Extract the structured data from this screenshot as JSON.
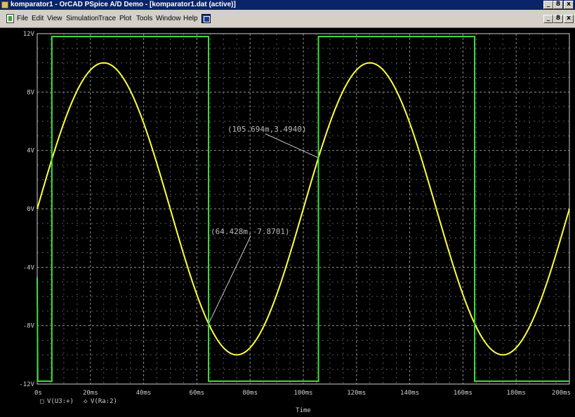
{
  "window": {
    "title": "komparator1 - OrCAD PSpice A/D Demo  - [komparator1.dat (active)]",
    "controls": [
      "_",
      "8",
      "x"
    ],
    "child_controls": [
      "_",
      "8",
      "x"
    ]
  },
  "menu": {
    "items": [
      "File",
      "Edit",
      "View",
      "Simulation",
      "Trace",
      "Plot",
      "Tools",
      "Window",
      "Help"
    ]
  },
  "colors": {
    "background": "#000000",
    "grid": "#a0a0a0",
    "sine": "#ffff40",
    "square": "#40e040"
  },
  "chart_data": {
    "type": "line",
    "title": "",
    "xlabel": "Time",
    "ylabel": "",
    "xlim": [
      0,
      200
    ],
    "ylim": [
      -12,
      12
    ],
    "x_unit": "ms",
    "y_unit": "V",
    "grid": true,
    "legend_placement": "bottom-left",
    "x_ticks": [
      "0s",
      "20ms",
      "40ms",
      "60ms",
      "80ms",
      "100ms",
      "120ms",
      "140ms",
      "160ms",
      "180ms",
      "200ms"
    ],
    "y_ticks": [
      "12V",
      "8V",
      "4V",
      "0V",
      "-4V",
      "-8V",
      "-12V"
    ],
    "series": [
      {
        "name": "V(U3:+)",
        "marker": "□",
        "color": "#ffff40",
        "kind": "sine",
        "amplitude": 10,
        "period_ms": 100,
        "offset": 0
      },
      {
        "name": "V(Ra:2)",
        "marker": "◇",
        "color": "#40e040",
        "kind": "steps",
        "points": [
          [
            0,
            -4.7
          ],
          [
            0.2,
            -11.8
          ],
          [
            5.5,
            -11.8
          ],
          [
            5.5,
            11.8
          ],
          [
            64.4,
            11.8
          ],
          [
            64.4,
            -11.8
          ],
          [
            105.7,
            -11.8
          ],
          [
            105.7,
            11.8
          ],
          [
            164.4,
            11.8
          ],
          [
            164.4,
            -11.8
          ],
          [
            200,
            -11.8
          ]
        ]
      }
    ],
    "annotations": [
      {
        "label": "(105.694m,3.4940)",
        "x": 105.694,
        "y": 3.494
      },
      {
        "label": "(64.428m,-7.8701)",
        "x": 64.428,
        "y": -7.8701
      }
    ]
  }
}
